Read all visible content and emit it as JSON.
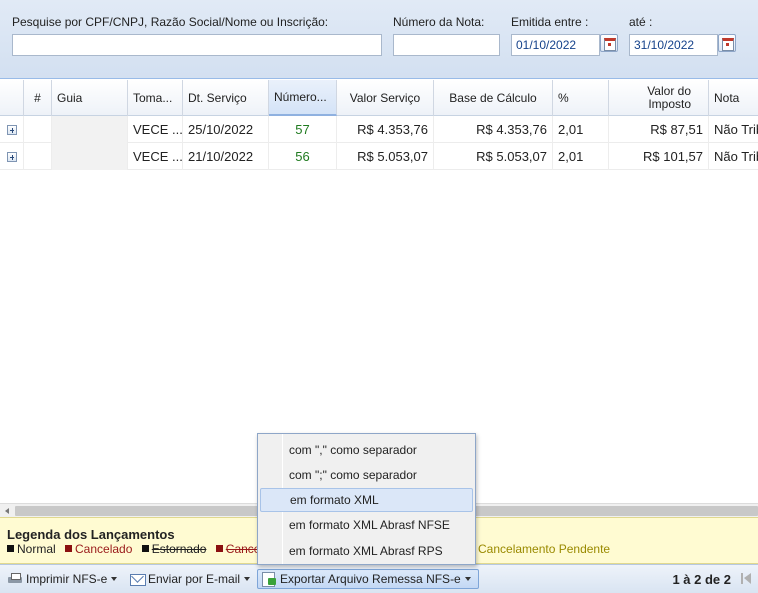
{
  "filters": {
    "search_label": "Pesquise por CPF/CNPJ, Razão Social/Nome ou Inscrição:",
    "search_value": "",
    "nota_label": "Número da Nota:",
    "nota_value": "",
    "emitida_label": "Emitida entre :",
    "emitida_value": "01/10/2022",
    "ate_label": "até :",
    "ate_value": "31/10/2022"
  },
  "grid": {
    "columns": [
      "",
      "#",
      "Guia",
      "Toma...",
      "Dt. Serviço",
      "Número...",
      "Valor Serviço",
      "Base de Cálculo",
      "%",
      "Valor do Imposto",
      "Nota"
    ],
    "rows": [
      {
        "num": "",
        "guia": "",
        "tomador": "VECE ...",
        "dt_servico": "25/10/2022",
        "numero": "57",
        "valor_servico": "R$ 4.353,76",
        "base_calculo": "R$ 4.353,76",
        "pct": "2,01",
        "valor_imposto": "R$ 87,51",
        "nota": "Não Trib"
      },
      {
        "num": "",
        "guia": "",
        "tomador": "VECE ...",
        "dt_servico": "21/10/2022",
        "numero": "56",
        "valor_servico": "R$ 5.053,07",
        "base_calculo": "R$ 5.053,07",
        "pct": "2,01",
        "valor_imposto": "R$ 101,57",
        "nota": "Não Trib"
      }
    ]
  },
  "legend": {
    "title": "Legenda dos Lançamentos",
    "normal": "Normal",
    "cancelado": "Cancelado",
    "estornado": "Estornado",
    "cancel_sub": "Cance",
    "pendente": "Cancelamento Pendente"
  },
  "toolbar": {
    "print_label": "Imprimir NFS-e",
    "email_label": "Enviar por E-mail",
    "export_label": "Exportar Arquivo Remessa NFS-e",
    "pager": "1 à 2 de 2"
  },
  "menu": {
    "items": [
      "com \",\" como separador",
      "com \";\" como separador",
      "em formato XML",
      "em formato XML Abrasf NFSE",
      "em formato XML Abrasf RPS"
    ],
    "active_index": 2
  },
  "colors": {
    "accent": "#15428b",
    "legend_bg": "#fffbd2",
    "numero_green": "#1f7a1f",
    "cancel_red": "#8b1010"
  }
}
